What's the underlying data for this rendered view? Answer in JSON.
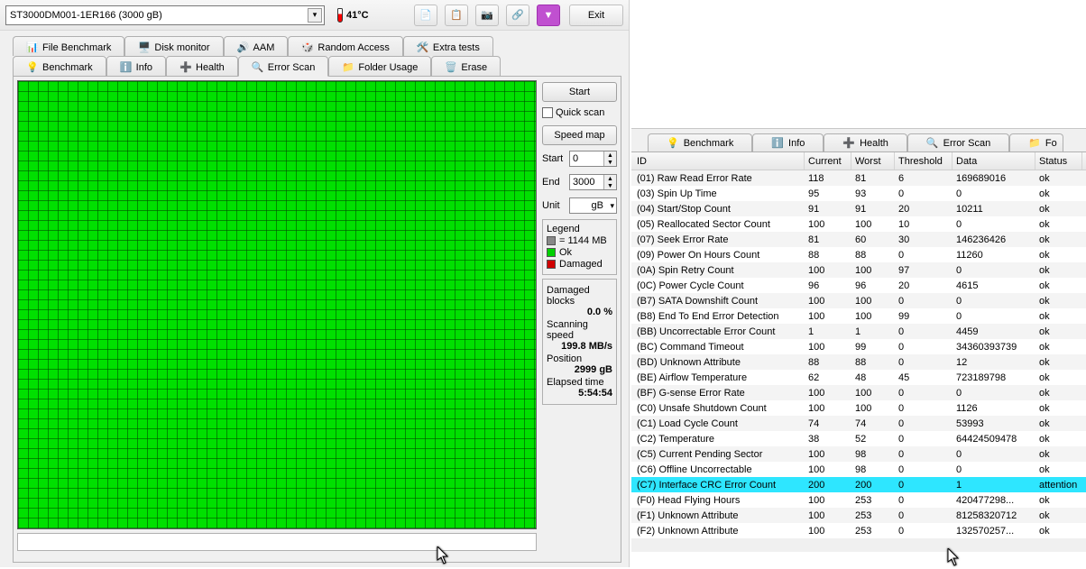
{
  "drive": {
    "name": "ST3000DM001-1ER166 (3000 gB)"
  },
  "temperature": "41°C",
  "exit": "Exit",
  "upper_tabs": [
    "File Benchmark",
    "Disk monitor",
    "AAM",
    "Random Access",
    "Extra tests"
  ],
  "lower_tabs": [
    "Benchmark",
    "Info",
    "Health",
    "Error Scan",
    "Folder Usage",
    "Erase"
  ],
  "scan": {
    "start_btn": "Start",
    "quick": "Quick scan",
    "speed_btn": "Speed map",
    "start_lbl": "Start",
    "start_val": "0",
    "end_lbl": "End",
    "end_val": "3000",
    "unit_lbl": "Unit",
    "unit_val": "gB",
    "legend_title": "Legend",
    "legend_block": " = 1144 MB",
    "legend_ok": "Ok",
    "legend_dmg": "Damaged",
    "stats": {
      "dmg_lbl": "Damaged blocks",
      "dmg_val": "0.0 %",
      "spd_lbl": "Scanning speed",
      "spd_val": "199.8 MB/s",
      "pos_lbl": "Position",
      "pos_val": "2999 gB",
      "elp_lbl": "Elapsed time",
      "elp_val": "5:54:54"
    }
  },
  "right_tabs": [
    "Benchmark",
    "Info",
    "Health",
    "Error Scan",
    "Fo"
  ],
  "smart_cols": {
    "id": "ID",
    "cur": "Current",
    "wor": "Worst",
    "thr": "Threshold",
    "dat": "Data",
    "sta": "Status"
  },
  "smart": [
    {
      "id": "(01) Raw Read Error Rate",
      "cur": "118",
      "wor": "81",
      "thr": "6",
      "dat": "169689016",
      "sta": "ok"
    },
    {
      "id": "(03) Spin Up Time",
      "cur": "95",
      "wor": "93",
      "thr": "0",
      "dat": "0",
      "sta": "ok"
    },
    {
      "id": "(04) Start/Stop Count",
      "cur": "91",
      "wor": "91",
      "thr": "20",
      "dat": "10211",
      "sta": "ok"
    },
    {
      "id": "(05) Reallocated Sector Count",
      "cur": "100",
      "wor": "100",
      "thr": "10",
      "dat": "0",
      "sta": "ok"
    },
    {
      "id": "(07) Seek Error Rate",
      "cur": "81",
      "wor": "60",
      "thr": "30",
      "dat": "146236426",
      "sta": "ok"
    },
    {
      "id": "(09) Power On Hours Count",
      "cur": "88",
      "wor": "88",
      "thr": "0",
      "dat": "11260",
      "sta": "ok"
    },
    {
      "id": "(0A) Spin Retry Count",
      "cur": "100",
      "wor": "100",
      "thr": "97",
      "dat": "0",
      "sta": "ok"
    },
    {
      "id": "(0C) Power Cycle Count",
      "cur": "96",
      "wor": "96",
      "thr": "20",
      "dat": "4615",
      "sta": "ok"
    },
    {
      "id": "(B7) SATA Downshift Count",
      "cur": "100",
      "wor": "100",
      "thr": "0",
      "dat": "0",
      "sta": "ok"
    },
    {
      "id": "(B8) End To End Error Detection",
      "cur": "100",
      "wor": "100",
      "thr": "99",
      "dat": "0",
      "sta": "ok"
    },
    {
      "id": "(BB) Uncorrectable Error Count",
      "cur": "1",
      "wor": "1",
      "thr": "0",
      "dat": "4459",
      "sta": "ok"
    },
    {
      "id": "(BC) Command Timeout",
      "cur": "100",
      "wor": "99",
      "thr": "0",
      "dat": "34360393739",
      "sta": "ok"
    },
    {
      "id": "(BD) Unknown Attribute",
      "cur": "88",
      "wor": "88",
      "thr": "0",
      "dat": "12",
      "sta": "ok"
    },
    {
      "id": "(BE) Airflow Temperature",
      "cur": "62",
      "wor": "48",
      "thr": "45",
      "dat": "723189798",
      "sta": "ok"
    },
    {
      "id": "(BF) G-sense Error Rate",
      "cur": "100",
      "wor": "100",
      "thr": "0",
      "dat": "0",
      "sta": "ok"
    },
    {
      "id": "(C0) Unsafe Shutdown Count",
      "cur": "100",
      "wor": "100",
      "thr": "0",
      "dat": "1126",
      "sta": "ok"
    },
    {
      "id": "(C1) Load Cycle Count",
      "cur": "74",
      "wor": "74",
      "thr": "0",
      "dat": "53993",
      "sta": "ok"
    },
    {
      "id": "(C2) Temperature",
      "cur": "38",
      "wor": "52",
      "thr": "0",
      "dat": "64424509478",
      "sta": "ok"
    },
    {
      "id": "(C5) Current Pending Sector",
      "cur": "100",
      "wor": "98",
      "thr": "0",
      "dat": "0",
      "sta": "ok"
    },
    {
      "id": "(C6) Offline Uncorrectable",
      "cur": "100",
      "wor": "98",
      "thr": "0",
      "dat": "0",
      "sta": "ok"
    },
    {
      "id": "(C7) Interface CRC Error Count",
      "cur": "200",
      "wor": "200",
      "thr": "0",
      "dat": "1",
      "sta": "attention",
      "hl": true
    },
    {
      "id": "(F0) Head Flying Hours",
      "cur": "100",
      "wor": "253",
      "thr": "0",
      "dat": "420477298...",
      "sta": "ok"
    },
    {
      "id": "(F1) Unknown Attribute",
      "cur": "100",
      "wor": "253",
      "thr": "0",
      "dat": "81258320712",
      "sta": "ok"
    },
    {
      "id": "(F2) Unknown Attribute",
      "cur": "100",
      "wor": "253",
      "thr": "0",
      "dat": "132570257...",
      "sta": "ok"
    }
  ]
}
